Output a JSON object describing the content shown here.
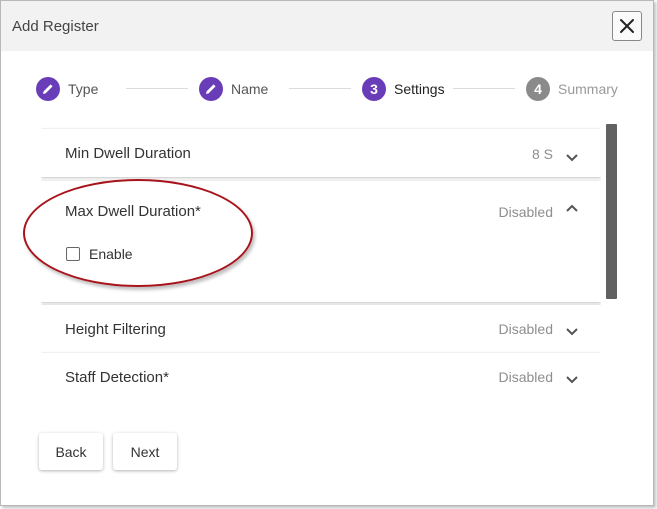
{
  "dialog": {
    "title": "Add Register",
    "close_icon": "close-x-icon"
  },
  "stepper": {
    "steps": [
      {
        "label": "Type",
        "state": "done",
        "icon": "pencil-icon"
      },
      {
        "label": "Name",
        "state": "done",
        "icon": "pencil-icon"
      },
      {
        "label": "Settings",
        "state": "active",
        "number": "3"
      },
      {
        "label": "Summary",
        "state": "pending",
        "number": "4"
      }
    ]
  },
  "settings": {
    "panels": [
      {
        "title": "Min Dwell Duration",
        "value": "8 S",
        "expanded": false
      },
      {
        "title": "Max Dwell Duration*",
        "value": "Disabled",
        "expanded": true,
        "checkbox": {
          "label": "Enable",
          "checked": false
        }
      },
      {
        "title": "Height Filtering",
        "value": "Disabled",
        "expanded": false
      },
      {
        "title": "Staff Detection*",
        "value": "Disabled",
        "expanded": false
      }
    ]
  },
  "footer": {
    "back_label": "Back",
    "next_label": "Next"
  },
  "colors": {
    "accent": "#6a3db8",
    "pending": "#8a8a8a",
    "annotation": "#a8141c"
  }
}
